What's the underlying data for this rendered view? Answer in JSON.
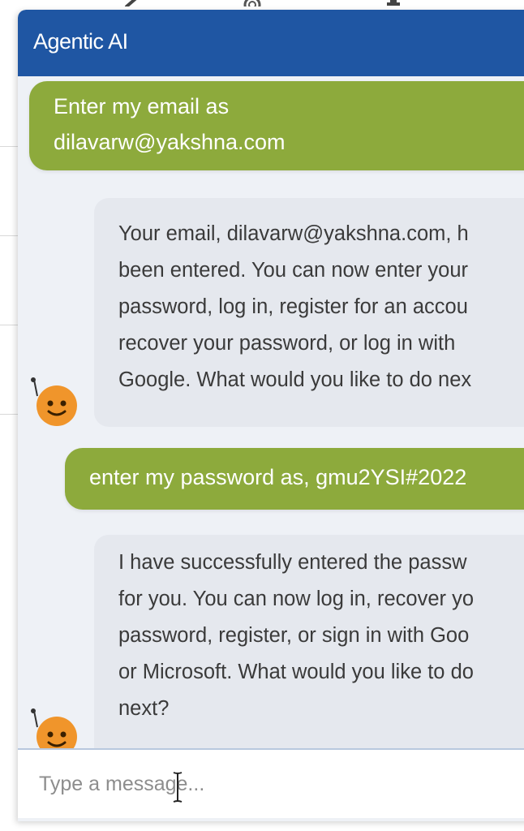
{
  "widget": {
    "title": "Agentic AI",
    "accent": "#1f56a3",
    "user_bubble_color": "#8daa3c",
    "bot_bubble_color": "#e5e8ee"
  },
  "messages": [
    {
      "role": "user",
      "lines": [
        "Enter my email as",
        "dilavarw@yakshna.com"
      ]
    },
    {
      "role": "bot",
      "avatar_icon": "robot-avatar-icon",
      "lines": [
        "Your email, dilavarw@yakshna.com, h",
        "been entered. You can now enter your",
        "password, log in, register for an accou",
        "recover your password, or log in with",
        "Google. What would you like to do nex"
      ]
    },
    {
      "role": "user",
      "lines": [
        "enter my password as, gmu2YSI#2022"
      ]
    },
    {
      "role": "bot",
      "avatar_icon": "robot-avatar-icon",
      "lines": [
        "I have successfully entered the passw",
        "for you. You can now log in, recover yo",
        "password, register, or sign in with Goo",
        "or Microsoft. What would you like to do",
        "next?"
      ]
    }
  ],
  "input": {
    "placeholder": "Type a message..."
  }
}
